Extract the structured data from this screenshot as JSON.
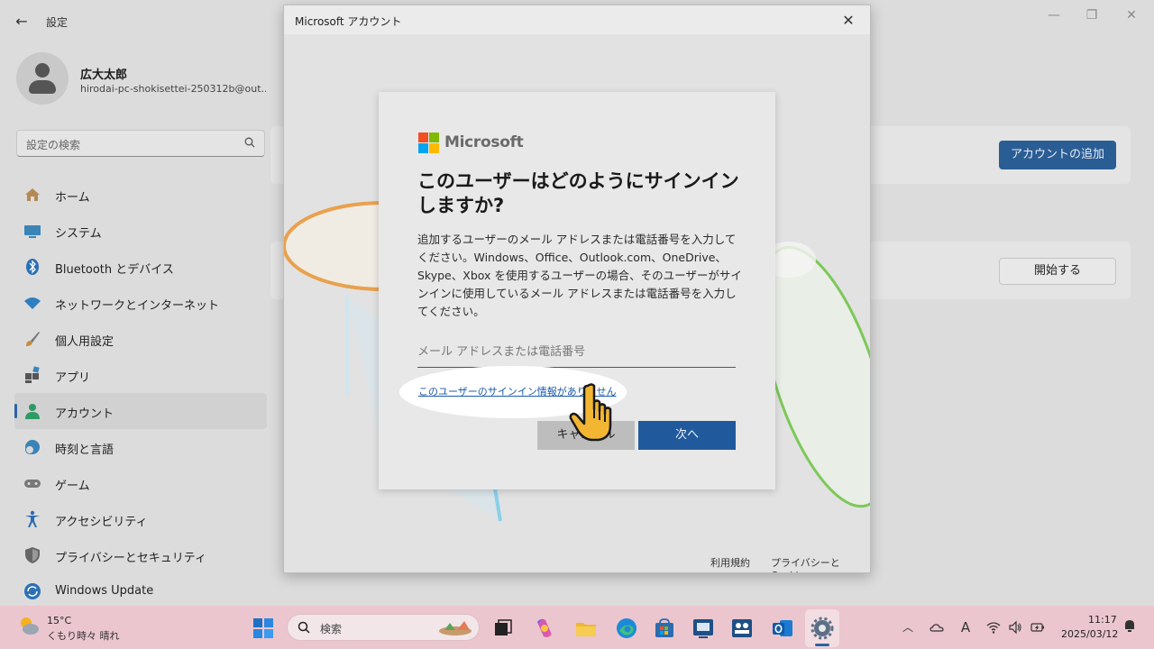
{
  "settings": {
    "back_icon": "back-arrow-icon",
    "title": "設定",
    "profile": {
      "name": "広大太郎",
      "email": "hirodai-pc-shokisettei-250312b@out..."
    },
    "search_placeholder": "設定の検索",
    "nav": [
      {
        "label": "ホーム",
        "icon": "home-icon"
      },
      {
        "label": "システム",
        "icon": "system-icon"
      },
      {
        "label": "Bluetooth とデバイス",
        "icon": "bluetooth-icon"
      },
      {
        "label": "ネットワークとインターネット",
        "icon": "wifi-icon"
      },
      {
        "label": "個人用設定",
        "icon": "brush-icon"
      },
      {
        "label": "アプリ",
        "icon": "apps-icon"
      },
      {
        "label": "アカウント",
        "icon": "account-icon",
        "active": true
      },
      {
        "label": "時刻と言語",
        "icon": "clock-globe-icon"
      },
      {
        "label": "ゲーム",
        "icon": "gamepad-icon"
      },
      {
        "label": "アクセシビリティ",
        "icon": "accessibility-icon"
      },
      {
        "label": "プライバシーとセキュリティ",
        "icon": "shield-icon"
      },
      {
        "label": "Windows Update",
        "icon": "update-icon"
      }
    ],
    "add_account_label": "アカウントの追加",
    "start_label": "開始する"
  },
  "dialog": {
    "window_title": "Microsoft アカウント",
    "brand": "Microsoft",
    "heading": "このユーザーはどのようにサインインしますか?",
    "description": "追加するユーザーのメール アドレスまたは電話番号を入力してください。Windows、Office、Outlook.com、OneDrive、Skype、Xbox を使用するユーザーの場合、そのユーザーがサインインに使用しているメール アドレスまたは電話番号を入力してください。",
    "input_placeholder": "メール アドレスまたは電話番号",
    "no_signin_link": "このユーザーのサインイン情報がありません",
    "cancel_label": "キャンセル",
    "next_label": "次へ",
    "footer_terms": "利用規約",
    "footer_privacy": "プライバシーと Cookie"
  },
  "taskbar": {
    "weather_temp": "15°C",
    "weather_condition": "くもり時々 晴れ",
    "search_placeholder": "検索",
    "time": "11:17",
    "date": "2025/03/12",
    "ime_indicator": "A"
  },
  "colors": {
    "accent": "#205a9c",
    "link": "#1a5aa8",
    "taskbar": "#ebc6cf",
    "ms_red": "#f25022",
    "ms_green": "#7fba00",
    "ms_blue": "#00a4ef",
    "ms_yellow": "#ffb900"
  }
}
